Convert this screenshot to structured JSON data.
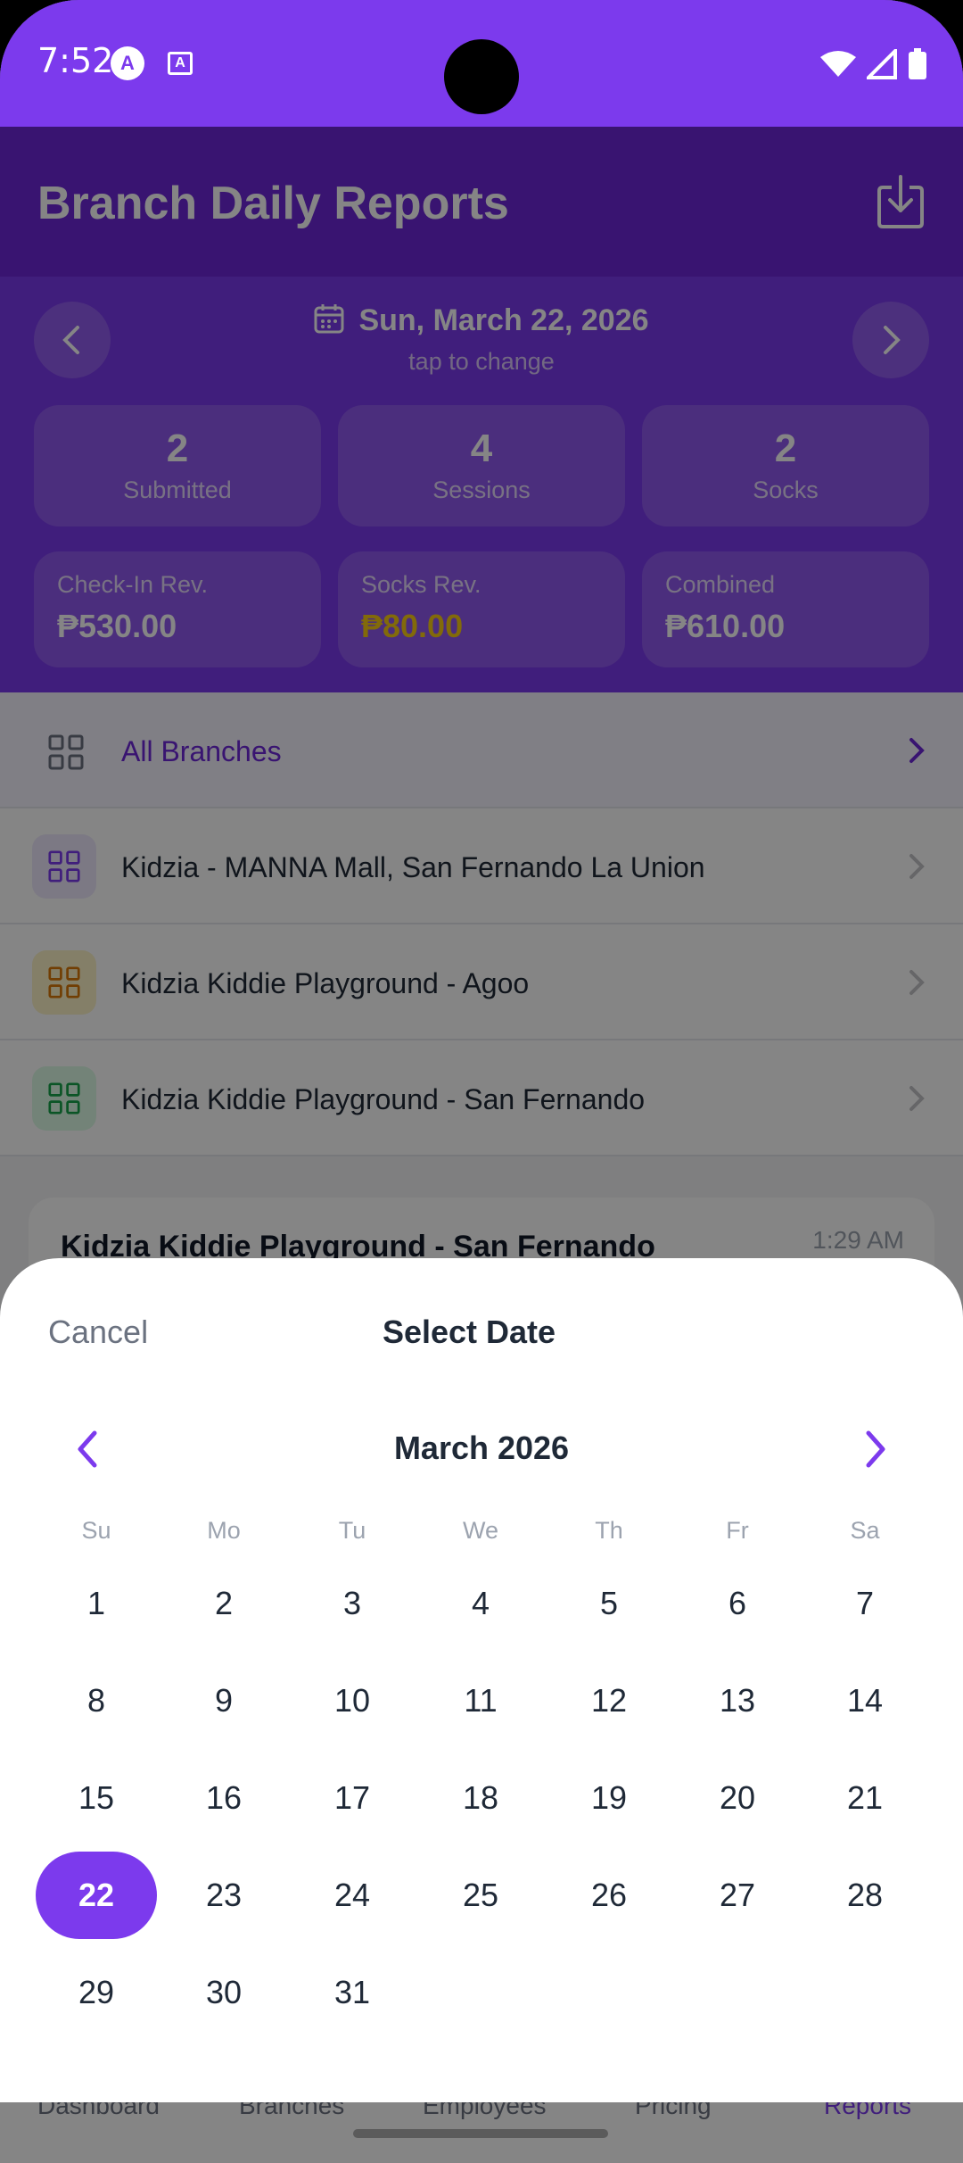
{
  "status_bar": {
    "time": "7:52",
    "app_icon_1": "A",
    "app_icon_2": "A"
  },
  "header": {
    "title": "Branch Daily Reports"
  },
  "date_picker": {
    "date": "Sun, March 22, 2026",
    "hint": "tap to change"
  },
  "stats": [
    {
      "value": "2",
      "label": "Submitted"
    },
    {
      "value": "4",
      "label": "Sessions"
    },
    {
      "value": "2",
      "label": "Socks"
    }
  ],
  "revenue": [
    {
      "label": "Check-In Rev.",
      "value": "₱530.00"
    },
    {
      "label": "Socks Rev.",
      "value": "₱80.00"
    },
    {
      "label": "Combined",
      "value": "₱610.00"
    }
  ],
  "branches": [
    {
      "label": "All Branches",
      "color": "#6b7280"
    },
    {
      "label": "Kidzia - MANNA Mall, San Fernando La Union",
      "color": "#7c3aed"
    },
    {
      "label": "Kidzia Kiddie Playground - Agoo",
      "color": "#d97706"
    },
    {
      "label": "Kidzia Kiddie Playground - San Fernando",
      "color": "#16a34a"
    }
  ],
  "report_card": {
    "title": "Kidzia Kiddie Playground - San Fernando",
    "time": "1:29 AM"
  },
  "bottom_nav": [
    {
      "label": "Dashboard"
    },
    {
      "label": "Branches"
    },
    {
      "label": "Employees"
    },
    {
      "label": "Pricing"
    },
    {
      "label": "Reports"
    }
  ],
  "sheet": {
    "cancel": "Cancel",
    "title": "Select Date",
    "month": "March 2026",
    "weekdays": [
      "Su",
      "Mo",
      "Tu",
      "We",
      "Th",
      "Fr",
      "Sa"
    ],
    "days": [
      "1",
      "2",
      "3",
      "4",
      "5",
      "6",
      "7",
      "8",
      "9",
      "10",
      "11",
      "12",
      "13",
      "14",
      "15",
      "16",
      "17",
      "18",
      "19",
      "20",
      "21",
      "22",
      "23",
      "24",
      "25",
      "26",
      "27",
      "28",
      "29",
      "30",
      "31"
    ],
    "selected_day": "22"
  },
  "colors": {
    "accent": "#7c3aed",
    "header": "#6d28d9",
    "gold": "#facc15"
  }
}
